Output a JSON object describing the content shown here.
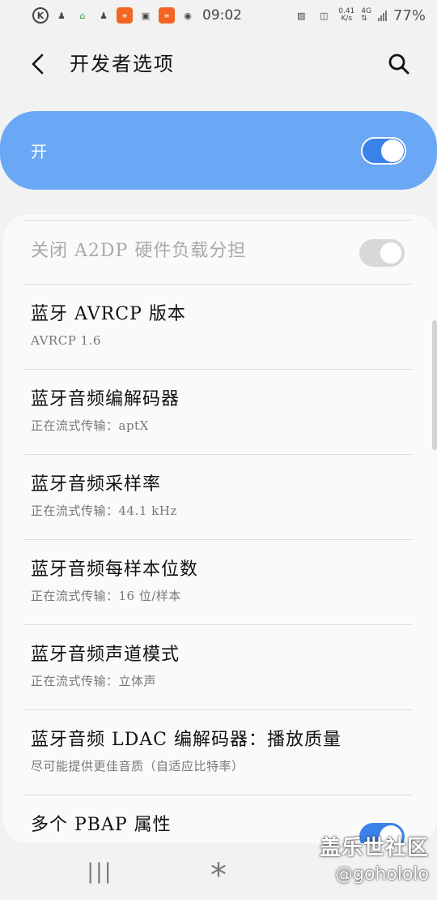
{
  "status_bar": {
    "time": "09:02",
    "speed_value": "0.41",
    "speed_unit": "K/s",
    "network": "4G",
    "battery": "77%"
  },
  "header": {
    "title": "开发者选项",
    "back_icon": "back-arrow-icon",
    "search_icon": "search-icon"
  },
  "master_switch": {
    "label": "开",
    "state": "on",
    "accent": "#6aa8f6"
  },
  "settings": [
    {
      "title": "关闭 A2DP 硬件负载分担",
      "subtitle": "",
      "toggle": "off-disabled",
      "disabled": true
    },
    {
      "title": "蓝牙 AVRCP 版本",
      "subtitle": "AVRCP 1.6"
    },
    {
      "title": "蓝牙音频编解码器",
      "subtitle": "正在流式传输：aptX"
    },
    {
      "title": "蓝牙音频采样率",
      "subtitle": "正在流式传输：44.1 kHz"
    },
    {
      "title": "蓝牙音频每样本位数",
      "subtitle": "正在流式传输：16 位/样本"
    },
    {
      "title": "蓝牙音频声道模式",
      "subtitle": "正在流式传输：立体声"
    },
    {
      "title": "蓝牙音频 LDAC 编解码器：播放质量",
      "subtitle": "尽可能提供更佳音质（自适应比特率）"
    },
    {
      "title": "多个 PBAP 属性",
      "subtitle": "",
      "toggle": "on"
    }
  ],
  "watermark": {
    "line1": "盖乐世社区",
    "line2": "@gohololo"
  },
  "colors": {
    "toggle_on": "#3a82ea",
    "background": "#f2f2f2"
  }
}
